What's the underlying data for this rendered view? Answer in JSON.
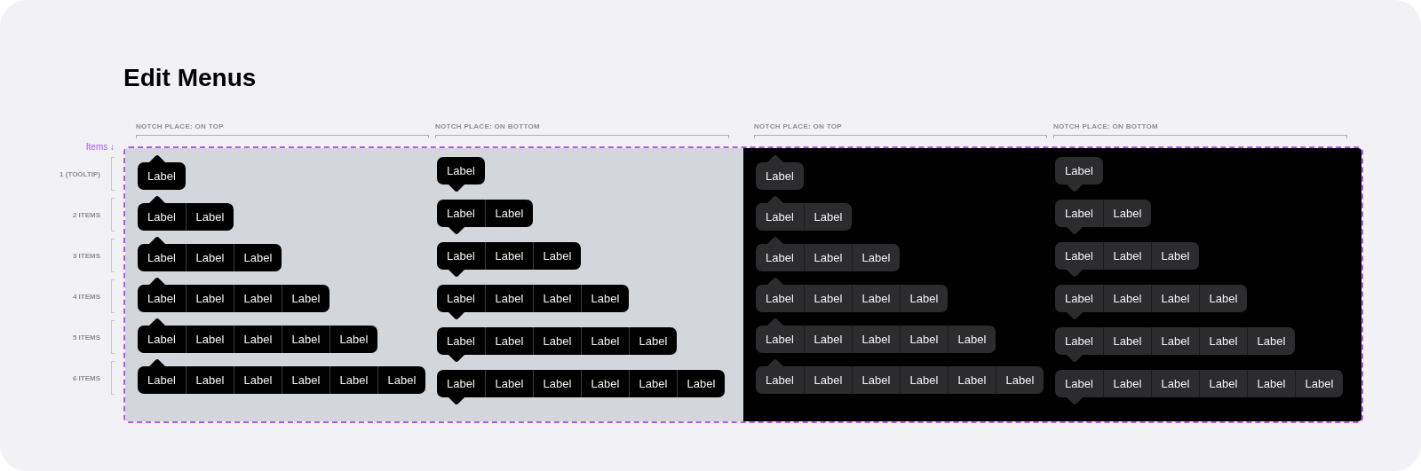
{
  "title": "Edit Menus",
  "legend": "Items ↓",
  "row_labels": [
    "1 (TOOLTIP)",
    "2 ITEMS",
    "3 ITEMS",
    "4 ITEMS",
    "5 ITEMS",
    "6 ITEMS"
  ],
  "panels": [
    {
      "kind": "light",
      "columns": [
        {
          "header": "NOTCH PLACE: ON TOP",
          "kind": "top",
          "menus": [
            {
              "items": [
                "Label"
              ]
            },
            {
              "items": [
                "Label",
                "Label"
              ]
            },
            {
              "items": [
                "Label",
                "Label",
                "Label"
              ]
            },
            {
              "items": [
                "Label",
                "Label",
                "Label",
                "Label"
              ]
            },
            {
              "items": [
                "Label",
                "Label",
                "Label",
                "Label",
                "Label"
              ]
            },
            {
              "items": [
                "Label",
                "Label",
                "Label",
                "Label",
                "Label",
                "Label"
              ]
            }
          ]
        },
        {
          "header": "NOTCH PLACE: ON BOTTOM",
          "kind": "bottom",
          "menus": [
            {
              "items": [
                "Label"
              ]
            },
            {
              "items": [
                "Label",
                "Label"
              ]
            },
            {
              "items": [
                "Label",
                "Label",
                "Label"
              ]
            },
            {
              "items": [
                "Label",
                "Label",
                "Label",
                "Label"
              ]
            },
            {
              "items": [
                "Label",
                "Label",
                "Label",
                "Label",
                "Label"
              ]
            },
            {
              "items": [
                "Label",
                "Label",
                "Label",
                "Label",
                "Label",
                "Label"
              ]
            }
          ]
        }
      ]
    },
    {
      "kind": "dark",
      "columns": [
        {
          "header": "NOTCH PLACE: ON TOP",
          "kind": "top",
          "menus": [
            {
              "items": [
                "Label"
              ]
            },
            {
              "items": [
                "Label",
                "Label"
              ]
            },
            {
              "items": [
                "Label",
                "Label",
                "Label"
              ]
            },
            {
              "items": [
                "Label",
                "Label",
                "Label",
                "Label"
              ]
            },
            {
              "items": [
                "Label",
                "Label",
                "Label",
                "Label",
                "Label"
              ]
            },
            {
              "items": [
                "Label",
                "Label",
                "Label",
                "Label",
                "Label",
                "Label"
              ]
            }
          ]
        },
        {
          "header": "NOTCH PLACE: ON BOTTOM",
          "kind": "bottom",
          "menus": [
            {
              "items": [
                "Label"
              ]
            },
            {
              "items": [
                "Label",
                "Label"
              ]
            },
            {
              "items": [
                "Label",
                "Label",
                "Label"
              ]
            },
            {
              "items": [
                "Label",
                "Label",
                "Label",
                "Label"
              ]
            },
            {
              "items": [
                "Label",
                "Label",
                "Label",
                "Label",
                "Label"
              ]
            },
            {
              "items": [
                "Label",
                "Label",
                "Label",
                "Label",
                "Label",
                "Label"
              ]
            }
          ]
        }
      ]
    }
  ]
}
